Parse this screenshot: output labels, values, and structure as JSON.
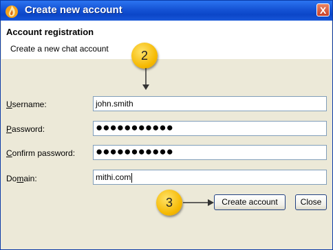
{
  "window": {
    "title": "Create new account",
    "close_label": "X"
  },
  "header": {
    "title": "Account registration",
    "subtitle": "Create a new chat account"
  },
  "form": {
    "username": {
      "label_key": "U",
      "label_rest": "sername:",
      "value": "john.smith"
    },
    "password": {
      "label_key": "P",
      "label_rest": "assword:",
      "value": "●●●●●●●●●●●"
    },
    "confirm": {
      "label_key": "C",
      "label_rest": "onfirm password:",
      "value": "●●●●●●●●●●●"
    },
    "domain": {
      "label_pre": "Do",
      "label_key": "m",
      "label_rest": "ain:",
      "value": "mithi.com"
    }
  },
  "buttons": {
    "create": "Create account",
    "close": "Close"
  },
  "callouts": {
    "step2": "2",
    "step3": "3"
  }
}
